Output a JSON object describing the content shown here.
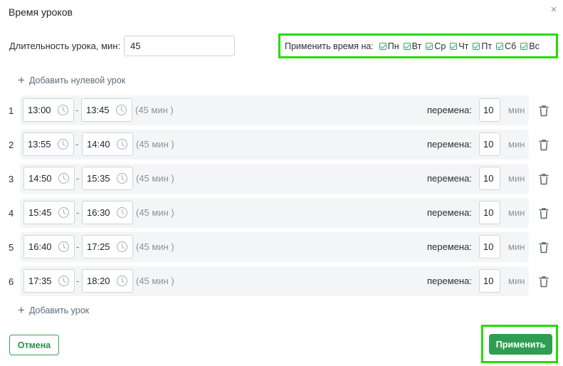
{
  "dialog": {
    "title": "Время уроков",
    "close_glyph": "×"
  },
  "duration": {
    "label": "Длительность урока, мин:",
    "value": "45"
  },
  "apply_days": {
    "label": "Применить время на:",
    "days": [
      {
        "label": "Пн",
        "checked": true
      },
      {
        "label": "Вт",
        "checked": true
      },
      {
        "label": "Ср",
        "checked": true
      },
      {
        "label": "Чт",
        "checked": true
      },
      {
        "label": "Пт",
        "checked": true
      },
      {
        "label": "Сб",
        "checked": true
      },
      {
        "label": "Вс",
        "checked": true
      }
    ]
  },
  "add_zero_lesson": "Добавить нулевой урок",
  "lessons": [
    {
      "num": "1",
      "start": "13:00",
      "end": "13:45",
      "duration": "(45 мин )",
      "break_label": "перемена:",
      "break_value": "10",
      "break_unit": "мин"
    },
    {
      "num": "2",
      "start": "13:55",
      "end": "14:40",
      "duration": "(45 мин )",
      "break_label": "перемена:",
      "break_value": "10",
      "break_unit": "мин"
    },
    {
      "num": "3",
      "start": "14:50",
      "end": "15:35",
      "duration": "(45 мин )",
      "break_label": "перемена:",
      "break_value": "10",
      "break_unit": "мин"
    },
    {
      "num": "4",
      "start": "15:45",
      "end": "16:30",
      "duration": "(45 мин )",
      "break_label": "перемена:",
      "break_value": "10",
      "break_unit": "мин"
    },
    {
      "num": "5",
      "start": "16:40",
      "end": "17:25",
      "duration": "(45 мин )",
      "break_label": "перемена:",
      "break_value": "10",
      "break_unit": "мин"
    },
    {
      "num": "6",
      "start": "17:35",
      "end": "18:20",
      "duration": "(45 мин )",
      "break_label": "перемена:",
      "break_value": "10",
      "break_unit": "мин"
    }
  ],
  "time_separator": "-",
  "add_lesson": "Добавить урок",
  "footer": {
    "cancel_label": "Отмена",
    "apply_label": "Применить"
  },
  "colors": {
    "accent": "#2e9f52",
    "highlight": "#22dd00",
    "row_bg": "#f4f5f7"
  },
  "icons": {
    "close": "close-icon",
    "add": "plus-icon",
    "clock": "clock-icon",
    "delete": "trash-icon",
    "check": "checkbox-checked-icon"
  }
}
